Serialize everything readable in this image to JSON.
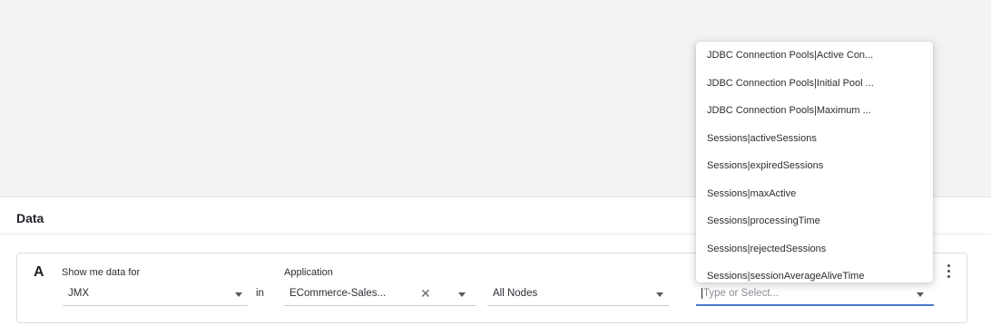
{
  "section": {
    "title": "Data"
  },
  "query": {
    "letter": "A",
    "source_label": "Show me data for",
    "source_value": "JMX",
    "connector": "in",
    "app_label": "Application",
    "app_value": "ECommerce-Sales...",
    "app_clear": "✕",
    "node_value": "All Nodes",
    "metric_placeholder": "Type or Select..."
  },
  "dropdown": {
    "items": [
      "JDBC Connection Pools|Active Con...",
      "JDBC Connection Pools|Initial Pool ...",
      "JDBC Connection Pools|Maximum ...",
      "Sessions|activeSessions",
      "Sessions|expiredSessions",
      "Sessions|maxActive",
      "Sessions|processingTime",
      "Sessions|rejectedSessions",
      "Sessions|sessionAverageAliveTime"
    ]
  }
}
